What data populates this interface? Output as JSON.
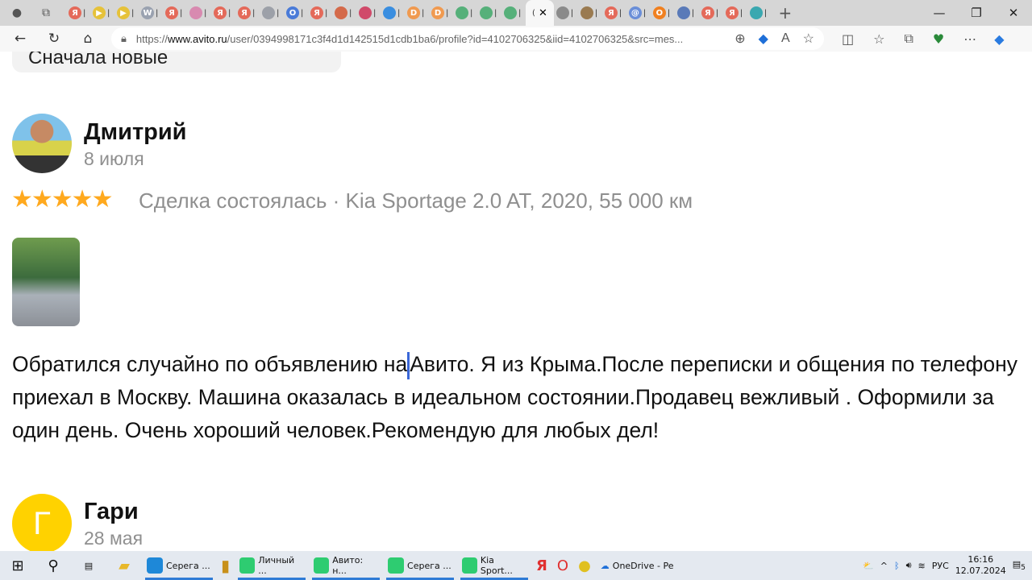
{
  "browser": {
    "tabs": [
      {
        "letter": "Я",
        "color": "#e46a5a"
      },
      {
        "letter": "▶",
        "color": "#e6c23a"
      },
      {
        "letter": "▶",
        "color": "#e6c23a"
      },
      {
        "letter": "W",
        "color": "#9aa2b0"
      },
      {
        "letter": "Я",
        "color": "#e46a5a"
      },
      {
        "letter": "",
        "color": "#d88ab0"
      },
      {
        "letter": "Я",
        "color": "#e46a5a"
      },
      {
        "letter": "Я",
        "color": "#e46a5a"
      },
      {
        "letter": "",
        "color": "#9ca0a8"
      },
      {
        "letter": "O",
        "color": "#4a7bd8"
      },
      {
        "letter": "Я",
        "color": "#e46a5a"
      },
      {
        "letter": "",
        "color": "#d46a4a"
      },
      {
        "letter": "",
        "color": "#d04a6a"
      },
      {
        "letter": "",
        "color": "#3a8ee0"
      },
      {
        "letter": "D",
        "color": "#f09a50"
      },
      {
        "letter": "D",
        "color": "#f09a50"
      },
      {
        "letter": "",
        "color": "#56b07a"
      },
      {
        "letter": "",
        "color": "#56b07a"
      },
      {
        "letter": "",
        "color": "#56b07a"
      }
    ],
    "tabs_after": [
      {
        "letter": "",
        "color": "#8a8a8a"
      },
      {
        "letter": "",
        "color": "#9a7a50"
      },
      {
        "letter": "Я",
        "color": "#e46a5a"
      },
      {
        "letter": "@",
        "color": "#6a8ed8"
      },
      {
        "letter": "О",
        "color": "#f08020"
      },
      {
        "letter": "",
        "color": "#5a7ab8"
      },
      {
        "letter": "Я",
        "color": "#e46a5a"
      },
      {
        "letter": "Я",
        "color": "#e46a5a"
      },
      {
        "letter": "",
        "color": "#3aa8b0"
      }
    ],
    "url_prefix": "https://",
    "url_domain": "www.avito.ru",
    "url_rest": "/user/0394998171c3f4d1d142515d1cdb1ba6/profile?id=4102706325&iid=4102706325&src=mes..."
  },
  "page": {
    "sort_label": "Сначала новые",
    "reviews": [
      {
        "author": "Дмитрий",
        "date": "8 июля",
        "rating": 5,
        "stars": "★★★★★",
        "deal": "Сделка состоялась · Kia Sportage 2.0 AT, 2020, 55 000 км",
        "text_before_caret": "Обратился случайно по объявлению на",
        "text_after_caret": "Авито. Я из Крыма.После переписки и общения по телефону приехал в Москву. Машина оказалась в идеальном состоянии.Продавец вежливый . Оформили за один день. Очень хороший человек.Рекомендую для любых дел!"
      },
      {
        "author": "Гари",
        "date": "28 мая",
        "initial": "Г",
        "avatar_color": "#ffd200"
      }
    ],
    "star_color": "#ffa91e"
  },
  "taskbar": {
    "apps": [
      {
        "label": "Серега ...",
        "color": "#1e88d8"
      },
      {
        "label": "Личный ...",
        "color": "#2ecc71"
      },
      {
        "label": "Авито: н...",
        "color": "#2ecc71"
      },
      {
        "label": "Серега ...",
        "color": "#2ecc71"
      },
      {
        "label": "Kia Sport...",
        "color": "#2ecc71"
      }
    ],
    "onedrive": "OneDrive - Pe",
    "lang": "РУС",
    "time": "16:16",
    "date": "12.07.2024",
    "notifications": "5"
  }
}
